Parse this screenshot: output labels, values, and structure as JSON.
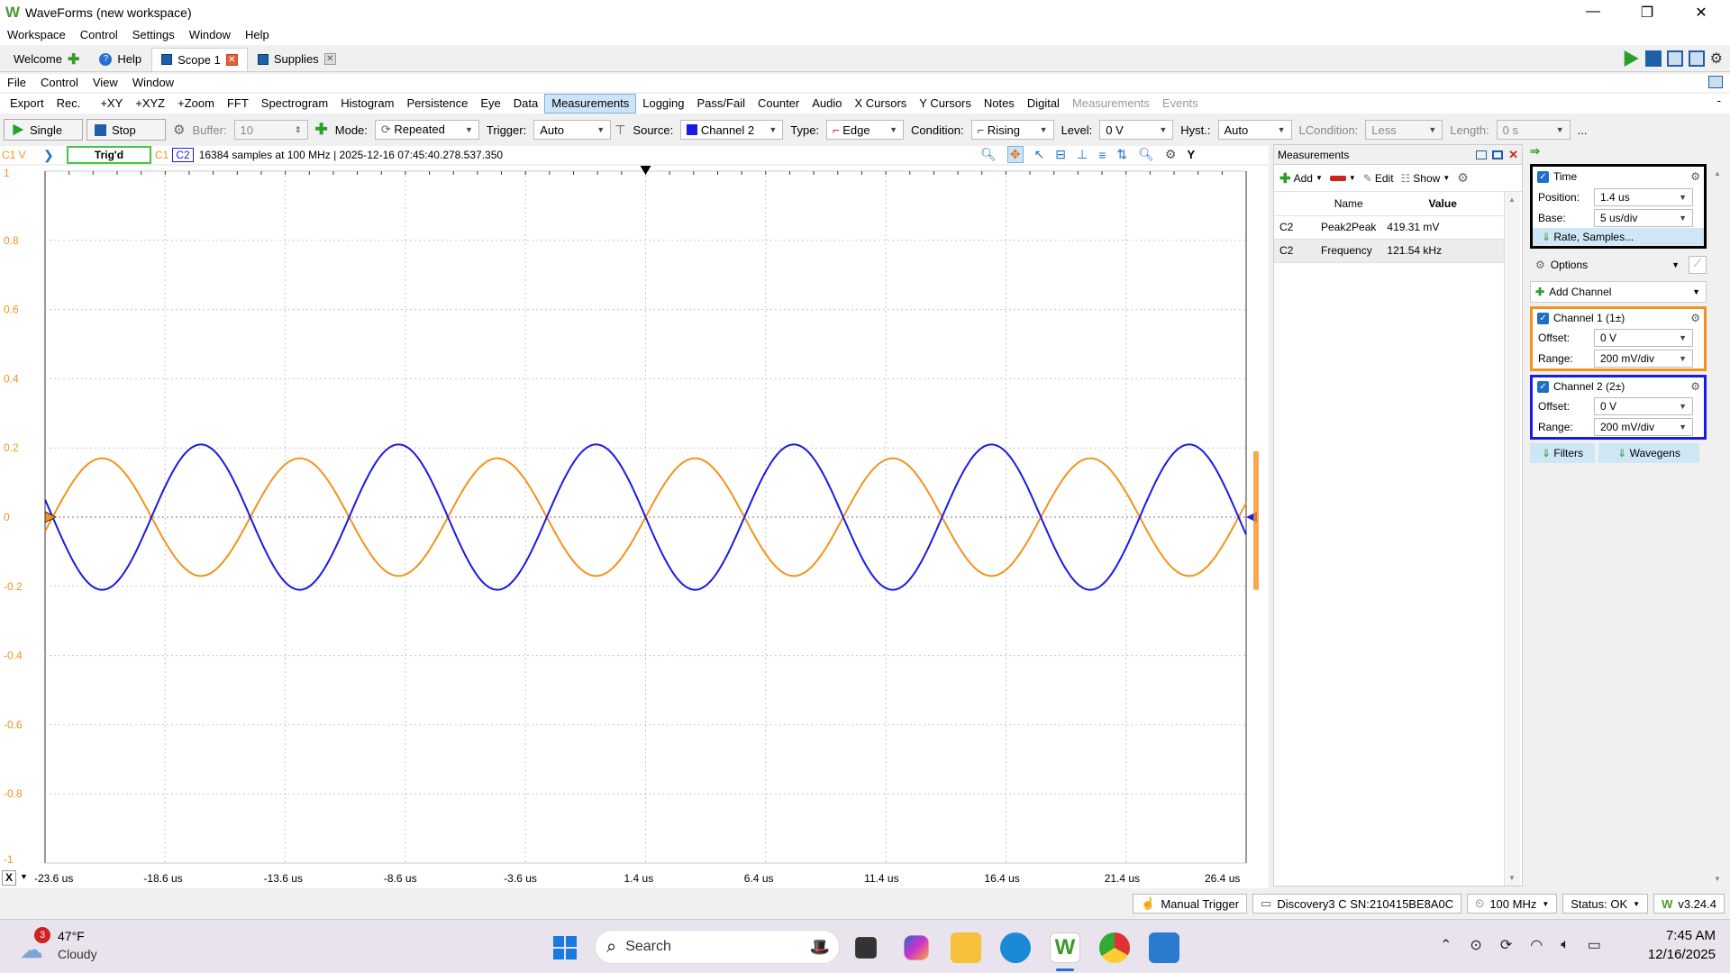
{
  "app": {
    "title": "WaveForms (new workspace)",
    "logo": "W"
  },
  "menubar": [
    "Workspace",
    "Control",
    "Settings",
    "Window",
    "Help"
  ],
  "tabs": [
    {
      "label": "Welcome",
      "icon": "plus-icon"
    },
    {
      "label": "Help",
      "icon": "help-icon"
    },
    {
      "label": "Scope 1",
      "icon": "scope-icon",
      "active": true
    },
    {
      "label": "Supplies",
      "icon": "supplies-icon"
    }
  ],
  "scope_menu": [
    "File",
    "Control",
    "View",
    "Window"
  ],
  "instrument_bar": [
    "Export",
    "Rec.",
    "+XY",
    "+XYZ",
    "+Zoom",
    "FFT",
    "Spectrogram",
    "Histogram",
    "Persistence",
    "Eye",
    "Data",
    "Measurements",
    "Logging",
    "Pass/Fail",
    "Counter",
    "Audio",
    "X Cursors",
    "Y Cursors",
    "Notes",
    "Digital",
    "Measurements",
    "Events"
  ],
  "instrument_selected": "Measurements",
  "controls": {
    "single": "Single",
    "stop": "Stop",
    "buffer_label": "Buffer:",
    "buffer_value": "10",
    "mode_label": "Mode:",
    "mode_value": "Repeated",
    "trigger_label": "Trigger:",
    "trigger_value": "Auto",
    "source_label": "Source:",
    "source_value": "Channel 2",
    "type_label": "Type:",
    "type_value": "Edge",
    "condition_label": "Condition:",
    "condition_value": "Rising",
    "level_label": "Level:",
    "level_value": "0 V",
    "hyst_label": "Hyst.:",
    "hyst_value": "Auto",
    "lcondition_label": "LCondition:",
    "lcondition_value": "Less",
    "length_label": "Length:",
    "length_value": "0 s",
    "more": "..."
  },
  "status": {
    "channel_label": "C1 V",
    "trig_state": "Trig'd",
    "c1": "C1",
    "c2": "C2",
    "info": "16384 samples at 100 MHz  | 2025-12-16 07:45:40.278.537.350",
    "y_button": "Y"
  },
  "plot": {
    "y_ticks": [
      "1",
      "0.8",
      "0.6",
      "0.4",
      "0.2",
      "0",
      "-0.2",
      "-0.4",
      "-0.6",
      "-0.8",
      "-1"
    ],
    "x_ticks": [
      "-23.6 us",
      "-18.6 us",
      "-13.6 us",
      "-8.6 us",
      "-3.6 us",
      "1.4 us",
      "6.4 us",
      "11.4 us",
      "16.4 us",
      "21.4 us",
      "26.4 us"
    ],
    "x_close": "X",
    "ch1_color": "#f5921e",
    "ch2_color": "#1a1ae6",
    "ch1_amplitude_v": 0.17,
    "ch2_amplitude_v": 0.21,
    "frequency_khz": 121.54
  },
  "measurements": {
    "title": "Measurements",
    "toolbar": {
      "add": "Add",
      "edit": "Edit",
      "show": "Show"
    },
    "headers": [
      "",
      "Name",
      "Value"
    ],
    "rows": [
      {
        "ch": "C2",
        "name": "Peak2Peak",
        "value": "419.31 mV"
      },
      {
        "ch": "C2",
        "name": "Frequency",
        "value": "121.54 kHz"
      }
    ]
  },
  "right": {
    "time": {
      "title": "Time",
      "position_label": "Position:",
      "position_value": "1.4 us",
      "base_label": "Base:",
      "base_value": "5 us/div",
      "rate_link": "Rate, Samples..."
    },
    "options": "Options",
    "add_channel": "Add Channel",
    "ch1": {
      "title": "Channel 1 (1±)",
      "offset_label": "Offset:",
      "offset_value": "0 V",
      "range_label": "Range:",
      "range_value": "200 mV/div",
      "color": "#f5921e"
    },
    "ch2": {
      "title": "Channel 2 (2±)",
      "offset_label": "Offset:",
      "offset_value": "0 V",
      "range_label": "Range:",
      "range_value": "200 mV/div",
      "color": "#1a1ae6"
    },
    "filters": "Filters",
    "wavegens": "Wavegens"
  },
  "bottom": {
    "manual_trigger": "Manual Trigger",
    "device": "Discovery3 C SN:210415BE8A0C",
    "clock": "100 MHz",
    "status": "Status: OK",
    "version": "v3.24.4"
  },
  "taskbar": {
    "weather_temp": "47°F",
    "weather_desc": "Cloudy",
    "weather_badge": "3",
    "search": "Search",
    "time": "7:45 AM",
    "date": "12/16/2025"
  }
}
